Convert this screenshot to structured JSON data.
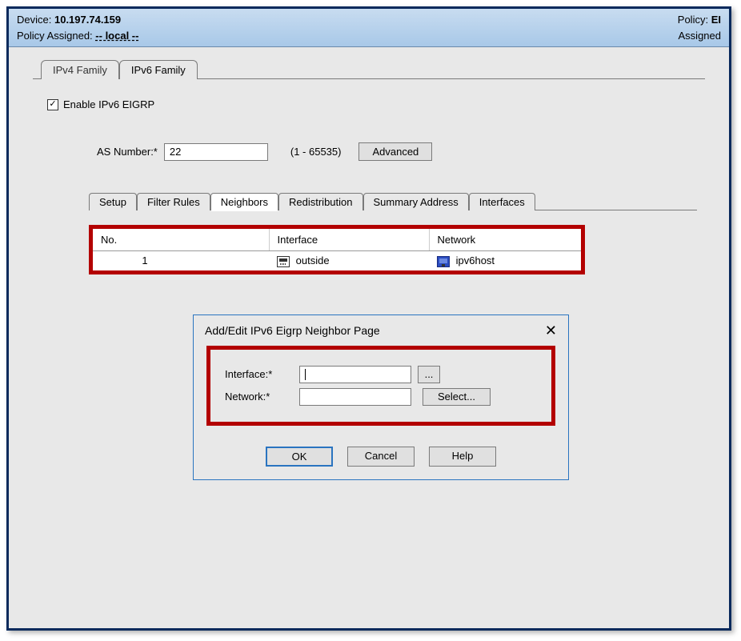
{
  "header": {
    "device_label": "Device:",
    "device_value": "10.197.74.159",
    "policy_assigned_label": "Policy Assigned:",
    "policy_assigned_value": "-- local --",
    "policy_label_right": "Policy:",
    "policy_value_right": "EI",
    "assigned_label_right": "Assigned"
  },
  "family_tabs": {
    "ipv4": "IPv4 Family",
    "ipv6": "IPv6 Family"
  },
  "enable_checkbox_label": "Enable IPv6 EIGRP",
  "as_number_label": "AS Number:*",
  "as_number_value": "22",
  "as_number_range": "(1 - 65535)",
  "advanced_button": "Advanced",
  "inner_tabs": {
    "setup": "Setup",
    "filter_rules": "Filter Rules",
    "neighbors": "Neighbors",
    "redistribution": "Redistribution",
    "summary_address": "Summary Address",
    "interfaces": "Interfaces"
  },
  "neighbors_table": {
    "headers": {
      "no": "No.",
      "interface": "Interface",
      "network": "Network"
    },
    "rows": [
      {
        "no": "1",
        "interface": "outside",
        "network": "ipv6host"
      }
    ]
  },
  "dialog": {
    "title": "Add/Edit IPv6 Eigrp Neighbor Page",
    "interface_label": "Interface:*",
    "network_label": "Network:*",
    "browse_button": "...",
    "select_button": "Select...",
    "ok": "OK",
    "cancel": "Cancel",
    "help": "Help",
    "interface_value": "",
    "network_value": ""
  }
}
